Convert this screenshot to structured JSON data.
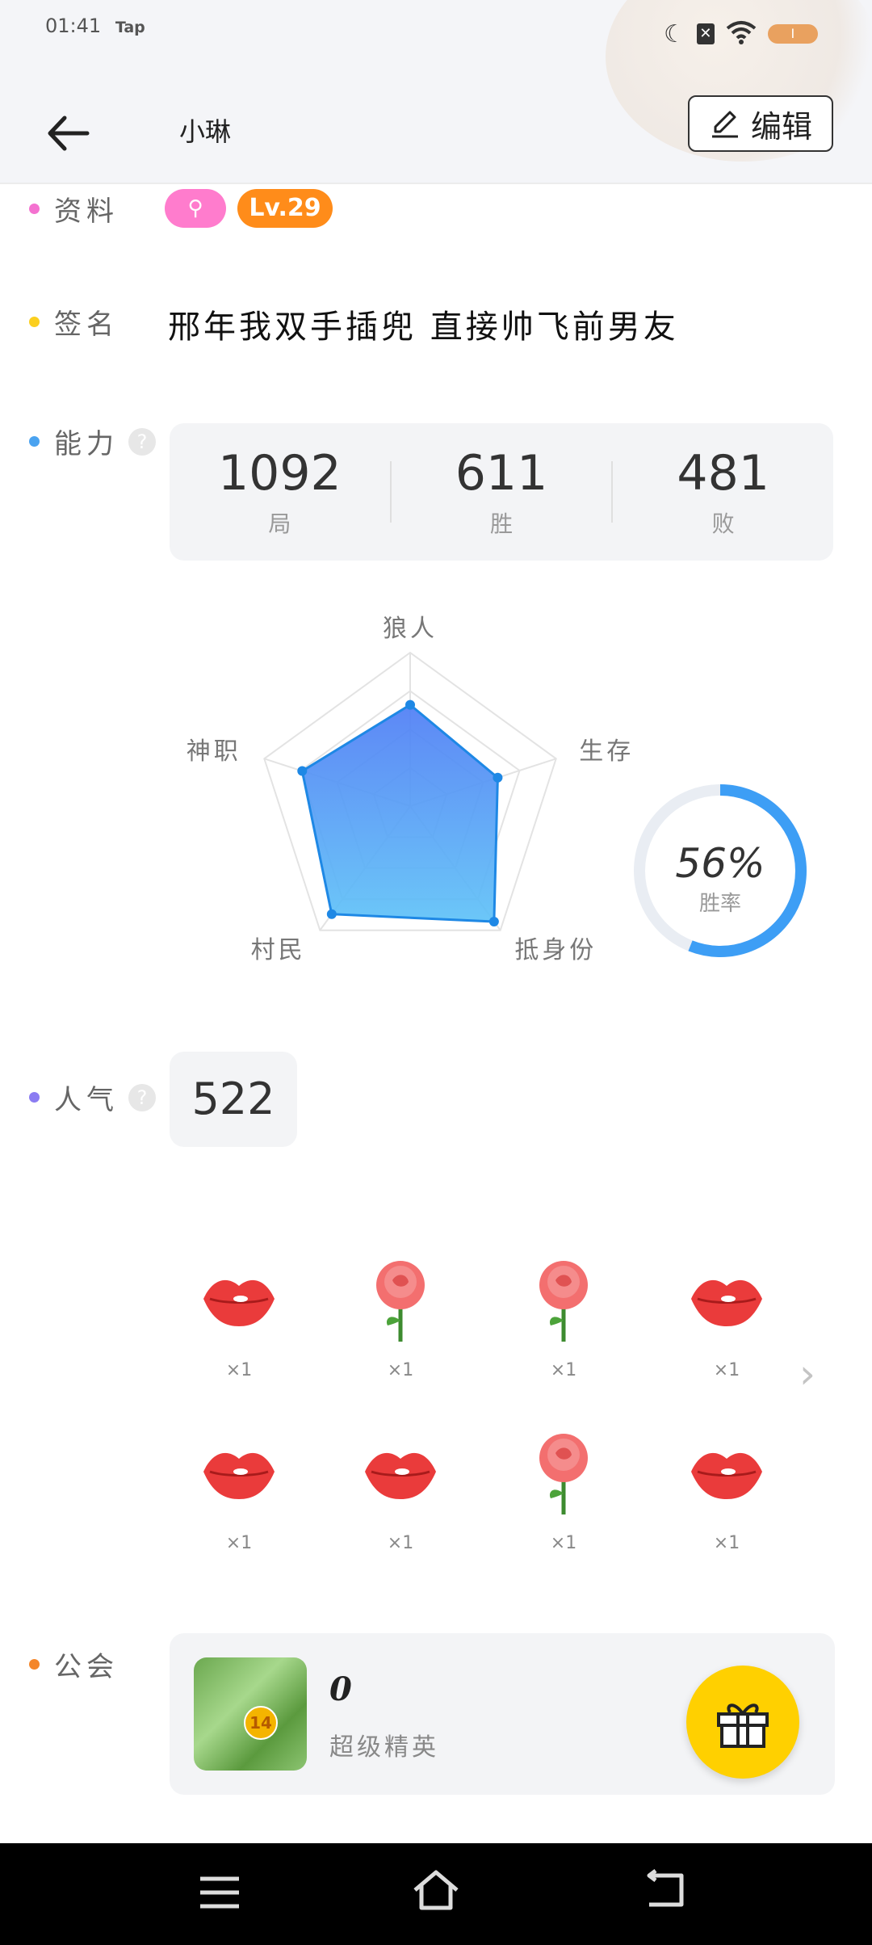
{
  "status_bar": {
    "time": "01:41",
    "app": "Tap",
    "battery": "I"
  },
  "header": {
    "title": "小琳",
    "edit_label": "编辑"
  },
  "profile": {
    "info_label": "资料",
    "badge_icon": "gender-badge",
    "level": "Lv.29",
    "signature_label": "签名",
    "signature": "邢年我双手插兜 直接帅飞前男友"
  },
  "ability": {
    "label": "能力",
    "help": "?",
    "stats": [
      {
        "value": "1092",
        "label": "局"
      },
      {
        "value": "611",
        "label": "胜"
      },
      {
        "value": "481",
        "label": "败"
      }
    ],
    "win_rate": {
      "value": "56%",
      "label": "胜率",
      "fraction": 0.56
    },
    "accent": "#1e88e5"
  },
  "chart_data": {
    "type": "radar",
    "axes": [
      "狼人",
      "生存",
      "抵身份",
      "村民",
      "神职"
    ],
    "values": [
      0.66,
      0.6,
      0.93,
      0.87,
      0.74
    ],
    "max": 1.0
  },
  "popularity": {
    "label": "人气",
    "help": "?",
    "value": "522"
  },
  "gifts": {
    "items": [
      {
        "icon": "lips-icon",
        "count": "×1"
      },
      {
        "icon": "rose-icon",
        "count": "×1"
      },
      {
        "icon": "rose-icon",
        "count": "×1"
      },
      {
        "icon": "lips-icon",
        "count": "×1"
      },
      {
        "icon": "lips-icon",
        "count": "×1"
      },
      {
        "icon": "lips-icon",
        "count": "×1"
      },
      {
        "icon": "rose-icon",
        "count": "×1"
      },
      {
        "icon": "lips-icon",
        "count": "×1"
      }
    ]
  },
  "guild": {
    "label": "公会",
    "name": "0",
    "rank": "超级精英",
    "level": "14"
  },
  "colors": {
    "info_dot": "#f472d0",
    "signature_dot": "#fbcf1f",
    "ability_dot": "#4aa3f0",
    "pop_dot": "#8b7cf2",
    "guild_dot": "#f4862a"
  }
}
